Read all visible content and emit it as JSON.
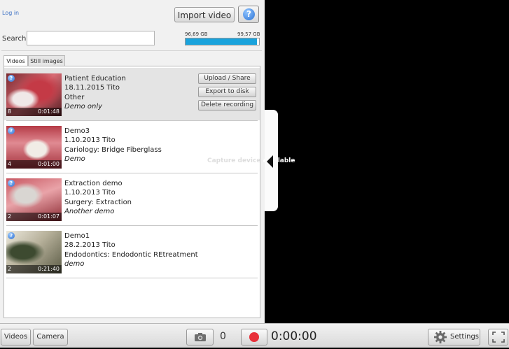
{
  "header": {
    "login_label": "Log in",
    "import_label": "Import video",
    "help_symbol": "?"
  },
  "search": {
    "label": "Search",
    "value": "",
    "placeholder": ""
  },
  "disk": {
    "used": "96,69 GB",
    "total": "99,57 GB",
    "used_fraction": 0.971
  },
  "tabs": [
    {
      "label": "Videos",
      "active": true
    },
    {
      "label": "Still images",
      "active": false
    }
  ],
  "recordings": [
    {
      "title": "Patient Education",
      "date_author": "18.11.2015 Tito",
      "category": "Other",
      "description": "Demo only",
      "count": "8",
      "duration": "0:01:48",
      "selected": true
    },
    {
      "title": "Demo3",
      "date_author": "1.10.2013 Tito",
      "category": "Cariology: Bridge Fiberglass",
      "description": "Demo",
      "count": "4",
      "duration": "0:01:00",
      "selected": false
    },
    {
      "title": "Extraction demo",
      "date_author": "1.10.2013 Tito",
      "category": "Surgery: Extraction",
      "description": "Another demo",
      "count": "2",
      "duration": "0:01:07",
      "selected": false
    },
    {
      "title": "Demo1",
      "date_author": "28.2.2013 Tito",
      "category": "Endodontics: Endodontic REtreatment",
      "description": "demo",
      "count": "2",
      "duration": "0:21:40",
      "selected": false
    }
  ],
  "actions": {
    "upload": "Upload / Share",
    "export": "Export to disk",
    "delete": "Delete recording"
  },
  "capture": {
    "dim_part": "Capture device",
    "tail": "available"
  },
  "bottom": {
    "videos": "Videos",
    "camera": "Camera",
    "photo_count": "0",
    "timer": "0:00:00",
    "settings": "Settings"
  },
  "colors": {
    "disk_bar": "#1aa3dc",
    "record_dot": "#e8303a",
    "help_blue": "#2e74d4"
  }
}
